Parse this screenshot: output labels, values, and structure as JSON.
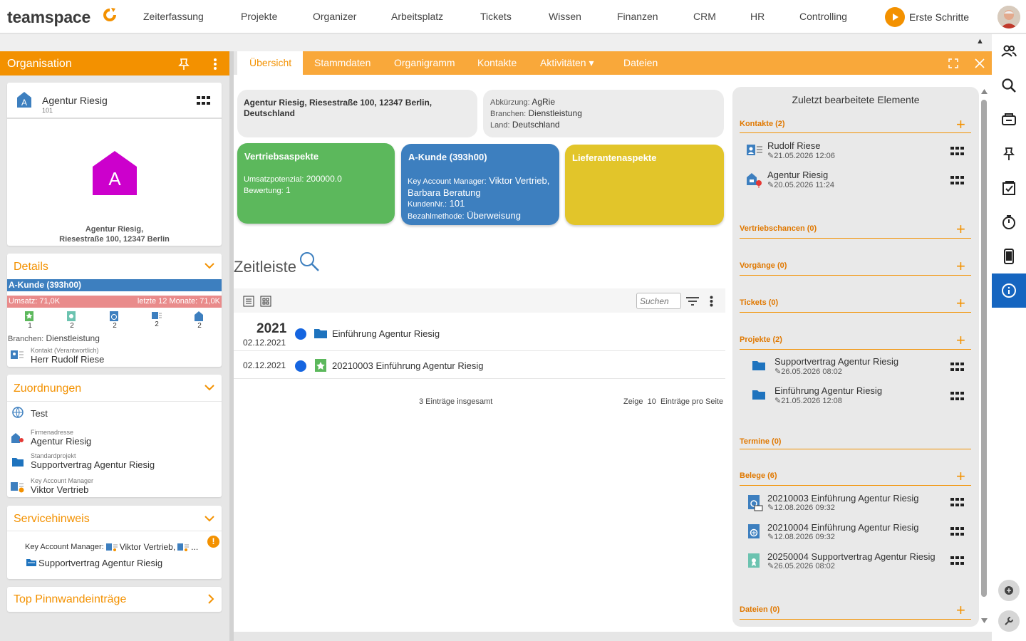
{
  "brand": {
    "logo_text": "teamspace",
    "accent": "#f39100",
    "blue": "#1565c0"
  },
  "nav": {
    "items": [
      "Zeiterfassung",
      "Projekte",
      "Organizer",
      "Arbeitsplatz",
      "Tickets",
      "Wissen",
      "Finanzen",
      "CRM",
      "HR",
      "Controlling"
    ],
    "erste": "Erste Schritte"
  },
  "left": {
    "title": "Organisation",
    "org": {
      "name": "Agentur Riesig",
      "number": "101",
      "avatar_letter": "A",
      "address_line1": "Agentur Riesig,",
      "address_line2": "Riesestraße 100, 12347 Berlin"
    },
    "details": {
      "title": "Details",
      "akunde": "A-Kunde (393h00)",
      "umsatz": "Umsatz: 71,0K",
      "letzte": "letzte 12 Monate: 71,0K",
      "counts": [
        "1",
        "2",
        "2",
        "2",
        "2"
      ],
      "branchen_label": "Branchen:",
      "branchen_value": "Dienstleistung",
      "kontakt_label": "Kontakt (Verantwortlich)",
      "kontakt_value": "Herr Rudolf Riese"
    },
    "zuordnungen": {
      "title": "Zuordnungen",
      "test": "Test",
      "firma_label": "Firmenadresse",
      "firma_value": "Agentur Riesig",
      "projekt_label": "Standardprojekt",
      "projekt_value": "Supportvertrag Agentur Riesig",
      "kam_label": "Key Account Manager",
      "kam_value": "Viktor Vertrieb"
    },
    "servicehinweis": {
      "title": "Servicehinweis",
      "kam_label": "Key Account Manager:",
      "kam_value": "Viktor Vertrieb,",
      "ellipsis": "...",
      "projekt": "Supportvertrag Agentur Riesig",
      "alert": "!"
    },
    "pinnwand": {
      "title": "Top Pinnwandeinträge"
    }
  },
  "tabs": [
    "Übersicht",
    "Stammdaten",
    "Organigramm",
    "Kontakte",
    "Aktivitäten ▾",
    "Dateien"
  ],
  "overview": {
    "address": "Agentur Riesig, Riesestraße 100, 12347 Berlin, Deutschland",
    "abk_label": "Abkürzung:",
    "abk_value": "AgRie",
    "branchen_label": "Branchen:",
    "branchen_value": "Dienstleistung",
    "land_label": "Land:",
    "land_value": "Deutschland",
    "vertrieb": {
      "title": "Vertriebsaspekte",
      "pot_label": "Umsatzpotenzial:",
      "pot_value": "200000.0",
      "bew_label": "Bewertung:",
      "bew_value": "1",
      "color": "#5cb85c"
    },
    "akunde": {
      "title": "A-Kunde (393h00)",
      "kam_label": "Key Account Manager:",
      "kam_value1": "Viktor Vertrieb,",
      "kam_value2": "Barbara Beratung",
      "kunden_label": "KundenNr.:",
      "kunden_value": "101",
      "bez_label": "Bezahlmethode:",
      "bez_value": "Überweisung",
      "color": "#3d7fbf"
    },
    "liefer": {
      "title": "Lieferantenaspekte",
      "color": "#e2c52a"
    }
  },
  "timeline": {
    "title": "Zeitleiste",
    "search_placeholder": "Suchen",
    "entries": [
      {
        "year": "2021",
        "date": "02.12.2021",
        "text": "Einführung Agentur Riesig"
      },
      {
        "year": "",
        "date": "02.12.2021",
        "text": "20210003 Einführung Agentur Riesig"
      }
    ],
    "total": "3 Einträge insgesamt",
    "show_label": "Zeige",
    "show_value": "10",
    "per_page": "Einträge pro Seite"
  },
  "recent": {
    "title": "Zuletzt bearbeitete Elemente",
    "kontakte": {
      "label": "Kontakte (2)",
      "items": [
        {
          "name": "Rudolf Riese",
          "date": "21.05.2026 12:06"
        },
        {
          "name": "Agentur Riesig",
          "date": "20.05.2026 11:24"
        }
      ]
    },
    "vertriebschancen": "Vertriebschancen (0)",
    "vorgaenge": "Vorgänge (0)",
    "tickets": "Tickets (0)",
    "projekte": {
      "label": "Projekte (2)",
      "items": [
        {
          "name": "Supportvertrag Agentur Riesig",
          "date": "26.05.2026 08:02"
        },
        {
          "name": "Einführung Agentur Riesig",
          "date": "21.05.2026 12:08"
        }
      ]
    },
    "termine": "Termine (0)",
    "belege": {
      "label": "Belege (6)",
      "items": [
        {
          "name": "20210003 Einführung Agentur Riesig",
          "date": "12.08.2026 09:32"
        },
        {
          "name": "20210004 Einführung Agentur Riesig",
          "date": "12.08.2026 09:32"
        },
        {
          "name": "20250004 Supportvertrag Agentur Riesig",
          "date": "26.05.2026 08:02"
        }
      ]
    },
    "dateien": "Dateien (0)"
  }
}
